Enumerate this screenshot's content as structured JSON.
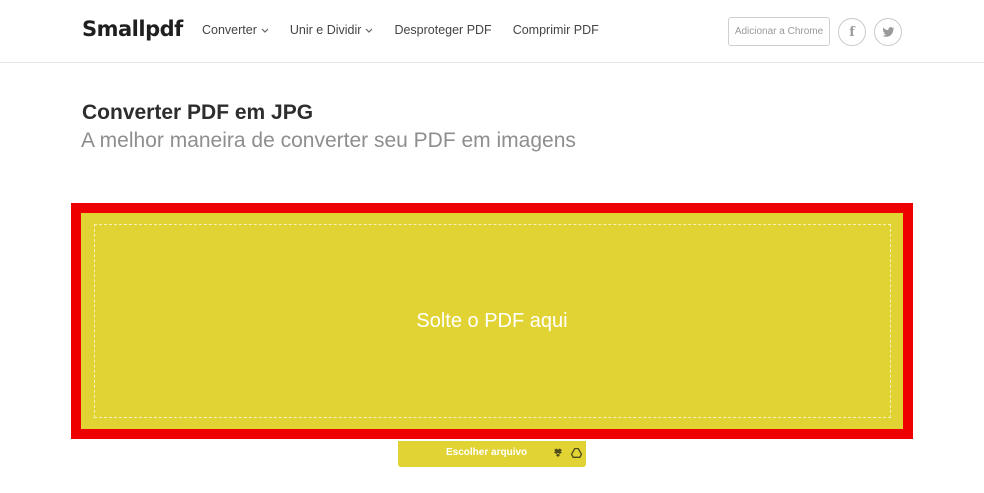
{
  "header": {
    "logo": "Smallpdf",
    "nav": [
      {
        "label": "Converter",
        "has_dropdown": true
      },
      {
        "label": "Unir e Dividir",
        "has_dropdown": true
      },
      {
        "label": "Desproteger PDF",
        "has_dropdown": false
      },
      {
        "label": "Comprimir PDF",
        "has_dropdown": false
      }
    ],
    "chrome_button": "Adicionar a Chrome",
    "social": {
      "facebook": "f",
      "twitter_icon": "twitter-icon"
    }
  },
  "main": {
    "title": "Converter PDF em JPG",
    "subtitle": "A melhor maneira de converter seu PDF em imagens",
    "dropzone_text": "Solte o PDF aqui",
    "choose_button": "Escolher arquivo",
    "source_icons": [
      "dropbox-icon",
      "google-drive-icon"
    ]
  },
  "colors": {
    "dropzone": "#e1d334",
    "highlight_frame": "#ee0000",
    "text_dark": "#2d2d2d",
    "text_muted": "#8e8e8e"
  }
}
